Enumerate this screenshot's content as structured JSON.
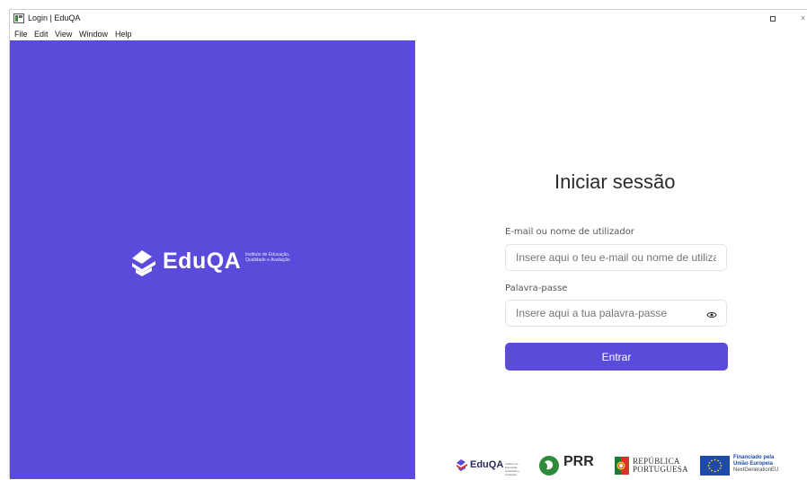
{
  "window": {
    "title": "Login | EduQA",
    "close_glyph": "×"
  },
  "menu": {
    "items": [
      "File",
      "Edit",
      "View",
      "Window",
      "Help"
    ]
  },
  "brand": {
    "name": "EduQA",
    "subtitle": "Instituto de Educação, Qualidade e Avaliação",
    "color": "#5b4bdb"
  },
  "login": {
    "title": "Iniciar sessão",
    "email_label": "E-mail ou nome de utilizador",
    "email_placeholder": "Insere aqui o teu e-mail ou nome de utilizador",
    "password_label": "Palavra-passe",
    "password_placeholder": "Insere aqui a tua palavra-passe",
    "submit_label": "Entrar"
  },
  "footer": {
    "eduqa_name": "EduQA",
    "prr_name": "PRR",
    "republica": "REPÚBLICA",
    "portuguesa": "PORTUGUESA",
    "eu_line1": "Financiado pela",
    "eu_line2": "União Europeia",
    "eu_line3": "NextGenerationEU"
  }
}
